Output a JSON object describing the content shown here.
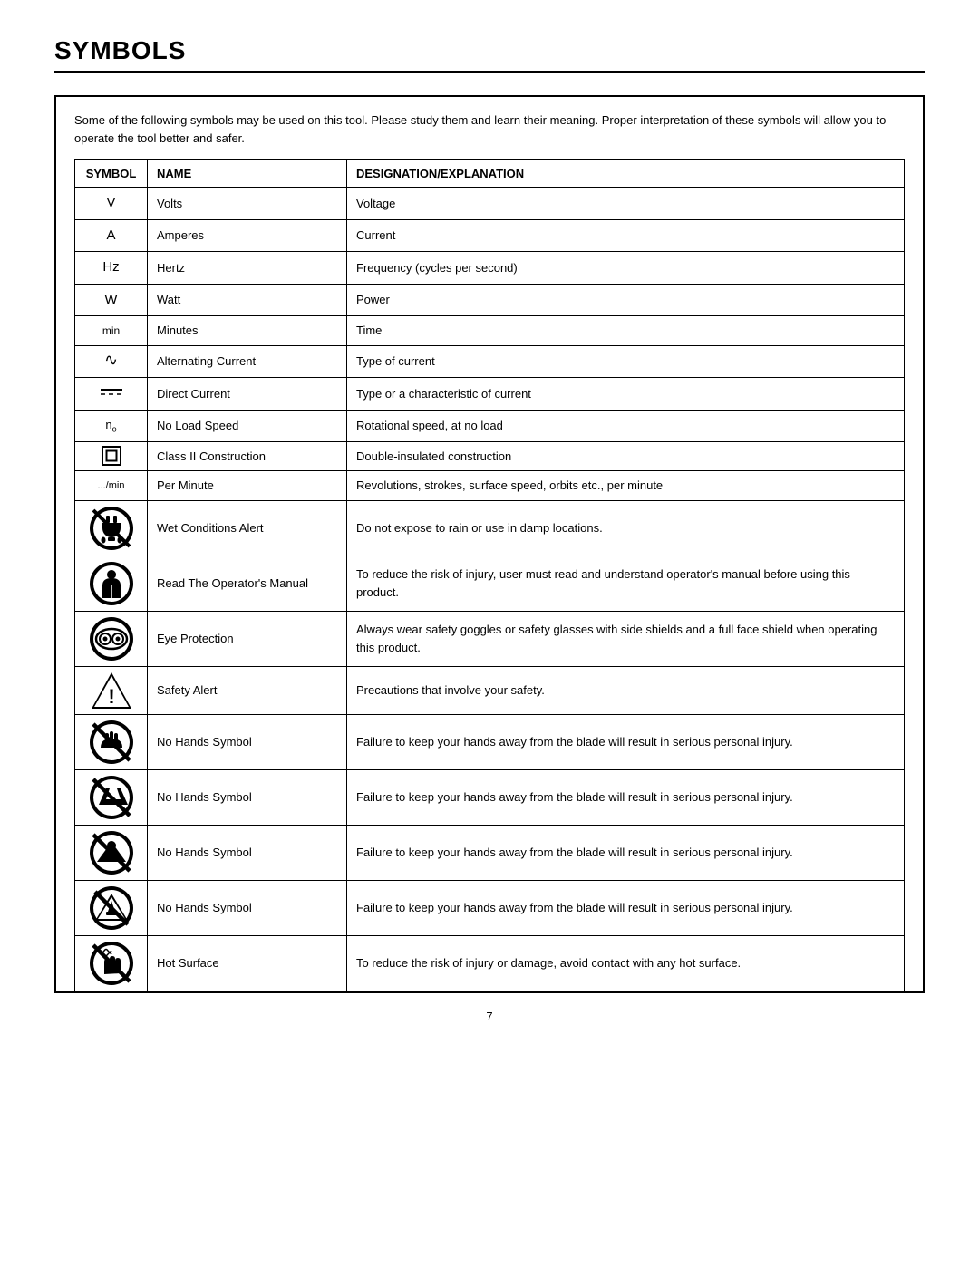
{
  "page": {
    "title": "SYMBOLS",
    "page_number": "7",
    "intro": "Some of the following symbols may be used on this tool. Please study them and learn their meaning. Proper interpretation of these symbols will allow you to operate the tool better and safer."
  },
  "table": {
    "headers": [
      "SYMBOL",
      "NAME",
      "DESIGNATION/EXPLANATION"
    ],
    "rows": [
      {
        "symbol": "V",
        "name": "Volts",
        "explanation": "Voltage"
      },
      {
        "symbol": "A",
        "name": "Amperes",
        "explanation": "Current"
      },
      {
        "symbol": "Hz",
        "name": "Hertz",
        "explanation": "Frequency (cycles per second)"
      },
      {
        "symbol": "W",
        "name": "Watt",
        "explanation": "Power"
      },
      {
        "symbol": "min",
        "name": "Minutes",
        "explanation": "Time"
      },
      {
        "symbol": "AC",
        "name": "Alternating Current",
        "explanation": "Type of current"
      },
      {
        "symbol": "DC",
        "name": "Direct Current",
        "explanation": "Type or a characteristic of current"
      },
      {
        "symbol": "NO",
        "name": "No Load Speed",
        "explanation": "Rotational speed, at no load"
      },
      {
        "symbol": "CLASS2",
        "name": "Class II Construction",
        "explanation": "Double-insulated construction"
      },
      {
        "symbol": ".../min",
        "name": "Per Minute",
        "explanation": "Revolutions, strokes, surface speed, orbits etc., per minute"
      },
      {
        "symbol": "WET",
        "name": "Wet Conditions Alert",
        "explanation": "Do not expose to rain or use in damp locations."
      },
      {
        "symbol": "MANUAL",
        "name": "Read The Operator's Manual",
        "explanation": "To reduce the risk of injury, user must read and understand operator's manual before using this product."
      },
      {
        "symbol": "EYE",
        "name": "Eye Protection",
        "explanation": "Always wear safety goggles or safety glasses with side shields and a full face shield when operating this product."
      },
      {
        "symbol": "SAFETY",
        "name": "Safety Alert",
        "explanation": "Precautions that involve your safety."
      },
      {
        "symbol": "NOHANDS1",
        "name": "No Hands Symbol",
        "explanation": "Failure to keep your hands away from the blade will result in serious personal injury."
      },
      {
        "symbol": "NOHANDS2",
        "name": "No Hands Symbol",
        "explanation": "Failure to keep your hands away from the blade will result in serious personal injury."
      },
      {
        "symbol": "NOHANDS3",
        "name": "No Hands Symbol",
        "explanation": "Failure to keep your hands away from the blade will result in serious personal injury."
      },
      {
        "symbol": "NOHANDS4",
        "name": "No Hands Symbol",
        "explanation": "Failure to keep your hands away from the blade will result in serious personal injury."
      },
      {
        "symbol": "HOT",
        "name": "Hot Surface",
        "explanation": "To reduce the risk of injury or damage, avoid contact with any hot surface."
      }
    ]
  }
}
